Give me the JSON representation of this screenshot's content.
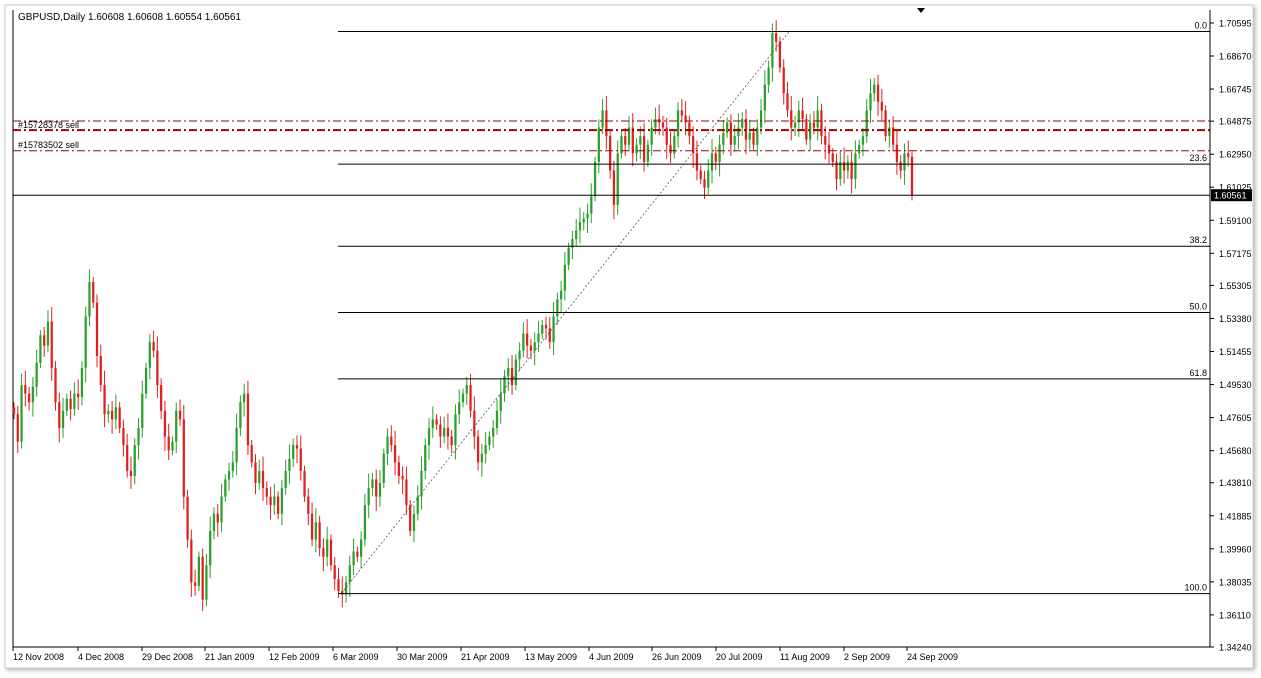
{
  "chart_data": {
    "type": "candlestick",
    "title": "GBPUSD,Daily  1.60608 1.60608 1.60554 1.60561",
    "symbol": "GBPUSD",
    "timeframe": "Daily",
    "ohlc_header": {
      "open": 1.60608,
      "high": 1.60608,
      "low": 1.60554,
      "close": 1.60561
    },
    "current_price": 1.60561,
    "current_price_label": "1.60561",
    "ylim": [
      1.3424,
      1.7135
    ],
    "y_ticks": [
      "1.70595",
      "1.68670",
      "1.66745",
      "1.64875",
      "1.62950",
      "1.61025",
      "1.59100",
      "1.57175",
      "1.55305",
      "1.53380",
      "1.51455",
      "1.49530",
      "1.47605",
      "1.45680",
      "1.43810",
      "1.41885",
      "1.39960",
      "1.38035",
      "1.36110",
      "1.34240"
    ],
    "x_labels": [
      "12 Nov 2008",
      "4 Dec 2008",
      "29 Dec 2008",
      "21 Jan 2009",
      "12 Feb 2009",
      "6 Mar 2009",
      "30 Mar 2009",
      "21 Apr 2009",
      "13 May 2009",
      "4 Jun 2009",
      "26 Jun 2009",
      "20 Jul 2009",
      "11 Aug 2009",
      "2 Sep 2009",
      "24 Sep 2009"
    ],
    "grid": false,
    "fibonacci": {
      "low": 1.3735,
      "high": 1.701,
      "levels": [
        {
          "ratio": 0.0,
          "label": "0.0"
        },
        {
          "ratio": 0.236,
          "label": "23.6"
        },
        {
          "ratio": 0.382,
          "label": "38.2"
        },
        {
          "ratio": 0.5,
          "label": "50.0"
        },
        {
          "ratio": 0.618,
          "label": "61.8"
        },
        {
          "ratio": 1.0,
          "label": "100.0"
        }
      ]
    },
    "orders": [
      {
        "label": "#15728378 sell",
        "price": 1.6488
      },
      {
        "label": "#15783502 sell",
        "price": 1.6315
      }
    ],
    "sell_levels": [
      1.6435
    ],
    "bull_color": "#2ca02c",
    "bear_color": "#e02020",
    "order_color": "#a00000",
    "trendline": {
      "from": {
        "x": "6 Mar 2009",
        "y": 1.3735
      },
      "to": {
        "x": "3 Aug 2009",
        "y": 1.701
      }
    },
    "closes": [
      1.478,
      1.462,
      1.495,
      1.49,
      1.485,
      1.494,
      1.508,
      1.524,
      1.518,
      1.532,
      1.505,
      1.485,
      1.47,
      1.48,
      1.487,
      1.481,
      1.49,
      1.488,
      1.505,
      1.535,
      1.555,
      1.543,
      1.512,
      1.495,
      1.478,
      1.48,
      1.475,
      1.482,
      1.47,
      1.46,
      1.445,
      1.442,
      1.46,
      1.47,
      1.49,
      1.505,
      1.52,
      1.515,
      1.495,
      1.48,
      1.465,
      1.457,
      1.462,
      1.48,
      1.475,
      1.43,
      1.405,
      1.38,
      1.378,
      1.395,
      1.37,
      1.39,
      1.41,
      1.42,
      1.415,
      1.43,
      1.44,
      1.445,
      1.45,
      1.47,
      1.485,
      1.49,
      1.46,
      1.45,
      1.438,
      1.445,
      1.435,
      1.43,
      1.425,
      1.43,
      1.42,
      1.435,
      1.445,
      1.452,
      1.46,
      1.458,
      1.445,
      1.43,
      1.42,
      1.405,
      1.415,
      1.4,
      1.395,
      1.405,
      1.39,
      1.382,
      1.375,
      1.373,
      1.38,
      1.39,
      1.398,
      1.395,
      1.405,
      1.425,
      1.435,
      1.44,
      1.43,
      1.438,
      1.455,
      1.465,
      1.46,
      1.45,
      1.442,
      1.44,
      1.425,
      1.41,
      1.42,
      1.43,
      1.445,
      1.46,
      1.47,
      1.475,
      1.472,
      1.465,
      1.47,
      1.465,
      1.46,
      1.478,
      1.485,
      1.49,
      1.495,
      1.48,
      1.465,
      1.45,
      1.455,
      1.46,
      1.465,
      1.47,
      1.48,
      1.49,
      1.5,
      1.505,
      1.495,
      1.51,
      1.515,
      1.525,
      1.518,
      1.515,
      1.52,
      1.525,
      1.53,
      1.528,
      1.52,
      1.535,
      1.545,
      1.55,
      1.565,
      1.575,
      1.58,
      1.585,
      1.59,
      1.592,
      1.595,
      1.605,
      1.625,
      1.645,
      1.655,
      1.64,
      1.62,
      1.6,
      1.63,
      1.64,
      1.635,
      1.645,
      1.63,
      1.635,
      1.64,
      1.625,
      1.635,
      1.645,
      1.65,
      1.648,
      1.645,
      1.635,
      1.63,
      1.64,
      1.655,
      1.652,
      1.648,
      1.64,
      1.63,
      1.62,
      1.615,
      1.61,
      1.62,
      1.63,
      1.625,
      1.635,
      1.642,
      1.648,
      1.635,
      1.64,
      1.645,
      1.65,
      1.638,
      1.642,
      1.635,
      1.645,
      1.655,
      1.67,
      1.68,
      1.7,
      1.695,
      1.68,
      1.665,
      1.655,
      1.645,
      1.648,
      1.655,
      1.65,
      1.638,
      1.648,
      1.645,
      1.655,
      1.64,
      1.635,
      1.63,
      1.625,
      1.615,
      1.625,
      1.62,
      1.625,
      1.615,
      1.63,
      1.635,
      1.64,
      1.655,
      1.665,
      1.67,
      1.66,
      1.655,
      1.64,
      1.645,
      1.635,
      1.625,
      1.62,
      1.63,
      1.628,
      1.6056
    ]
  }
}
